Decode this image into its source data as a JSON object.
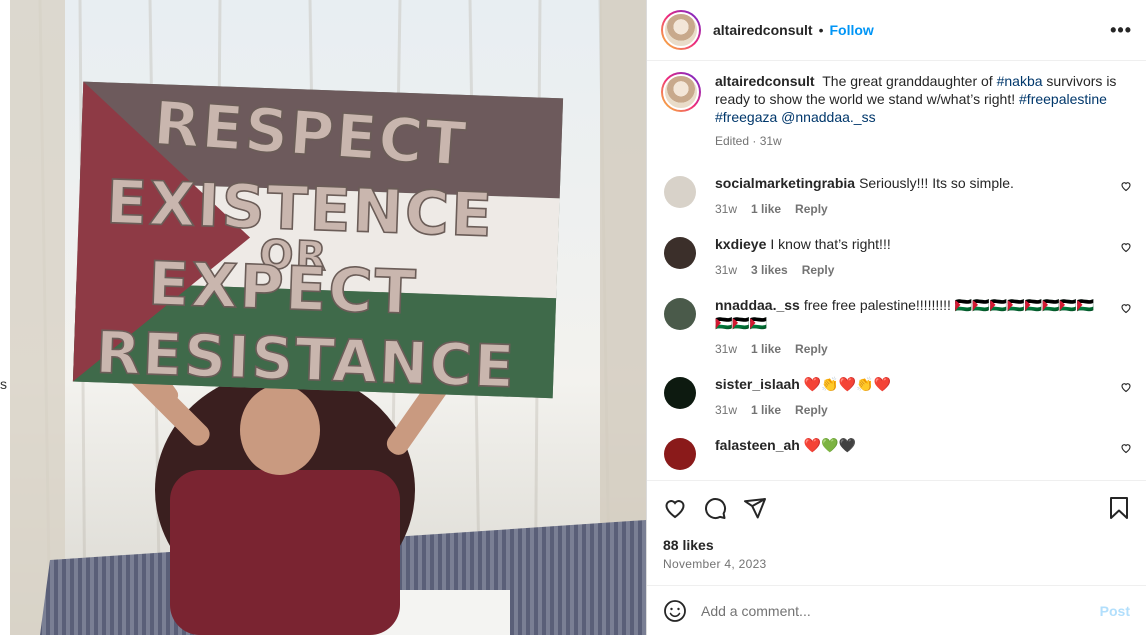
{
  "photo": {
    "sign_lines": [
      "RESPECT",
      "EXISTENCE",
      "OR",
      "EXPECT",
      "RESISTANCE"
    ]
  },
  "backdrop_glyph": "s",
  "header": {
    "username": "altairedconsult",
    "separator": "•",
    "follow_label": "Follow",
    "more_icon": "more-horizontal-icon",
    "more_glyph": "•••"
  },
  "caption": {
    "username": "altairedconsult",
    "text_before": "The great granddaughter of",
    "hashtag_nakba": "#nakba",
    "text_after": "survivors is ready to show the world we stand w/what’s right!",
    "hashtag_1": "#freepalestine",
    "hashtag_2": "#freegaza",
    "mention": "@nnaddaa._ss",
    "meta": "Edited · 31w"
  },
  "comments": [
    {
      "username": "socialmarketingrabia",
      "text": "Seriously!!! Its so simple.",
      "time": "31w",
      "likes": "1 like",
      "reply": "Reply",
      "avatar_color": "#d8d2c9"
    },
    {
      "username": "kxdieye",
      "text": "I know that’s right!!!",
      "time": "31w",
      "likes": "3 likes",
      "reply": "Reply",
      "avatar_color": "#3b2f2a"
    },
    {
      "username": "nnaddaa._ss",
      "text": "free free palestine!!!!!!!!! 🇵🇸🇵🇸🇵🇸🇵🇸🇵🇸🇵🇸🇵🇸🇵🇸🇵🇸🇵🇸🇵🇸",
      "time": "31w",
      "likes": "1 like",
      "reply": "Reply",
      "avatar_color": "#4a5a4a"
    },
    {
      "username": "sister_islaah",
      "text": "❤️👏❤️👏❤️",
      "time": "31w",
      "likes": "1 like",
      "reply": "Reply",
      "avatar_color": "#0d1a10"
    },
    {
      "username": "falasteen_ah",
      "text": "❤️💚🖤",
      "time": "",
      "likes": "",
      "reply": "",
      "avatar_color": "#8a1a1a"
    }
  ],
  "actions": {
    "likes": "88 likes",
    "date": "November 4, 2023",
    "icons": [
      "heart-icon",
      "comment-icon",
      "share-icon",
      "bookmark-icon"
    ]
  },
  "comment_bar": {
    "placeholder": "Add a comment...",
    "post_label": "Post",
    "emoji_icon": "emoji-icon"
  },
  "colors": {
    "accent": "#0095f6",
    "link": "#00376b",
    "muted": "#737373",
    "post_disabled": "#b2dffc"
  }
}
